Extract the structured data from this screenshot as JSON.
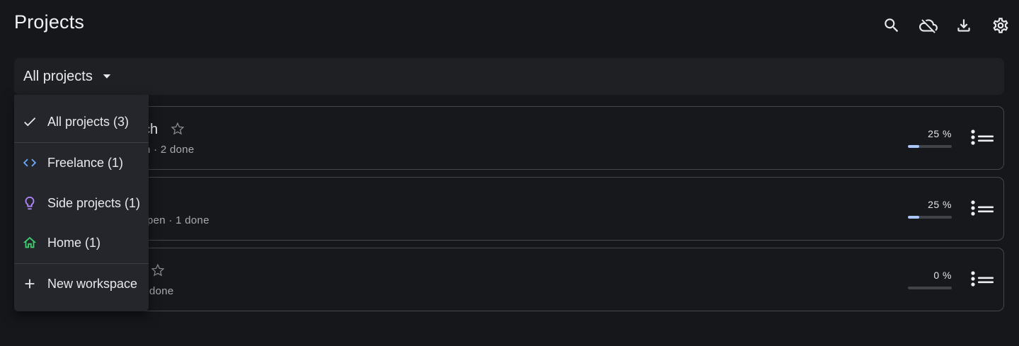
{
  "header": {
    "title": "Projects",
    "tools": [
      {
        "name": "search",
        "icon": "search-icon"
      },
      {
        "name": "cloud-off",
        "icon": "cloud-off-icon"
      },
      {
        "name": "download",
        "icon": "download-icon"
      },
      {
        "name": "settings",
        "icon": "gear-icon"
      }
    ]
  },
  "filter": {
    "selected_label": "All projects",
    "caret_icon": "caret-down-icon"
  },
  "dropdown": {
    "items": [
      {
        "label": "All projects (3)",
        "icon": "check-icon",
        "icon_color": "#e8e9ec",
        "selected": true
      },
      {
        "label": "Freelance (1)",
        "icon": "code-icon",
        "icon_color": "#6ea8fe"
      },
      {
        "label": "Side projects (1)",
        "icon": "lightbulb-icon",
        "icon_color": "#b388ff"
      },
      {
        "label": "Home (1)",
        "icon": "home-icon",
        "icon_color": "#3ecf6e"
      },
      {
        "label": "New workspace",
        "icon": "plus-icon",
        "icon_color": "#e8e9ec"
      }
    ]
  },
  "projects": [
    {
      "name_visible": "ch",
      "meta_visible": "n · 2 done",
      "progress_label": "25 %",
      "progress": 0.25,
      "starred": false
    },
    {
      "name_visible": "",
      "meta_visible": "pen · 1 done",
      "progress_label": "25 %",
      "progress": 0.25,
      "starred": false
    },
    {
      "name_visible": "",
      "meta_visible": "done",
      "progress_label": "0 %",
      "progress": 0.0,
      "starred": false
    }
  ],
  "colors": {
    "background": "#16171b",
    "accent_progress": "#aac7ff",
    "card_border": "#45474c"
  }
}
